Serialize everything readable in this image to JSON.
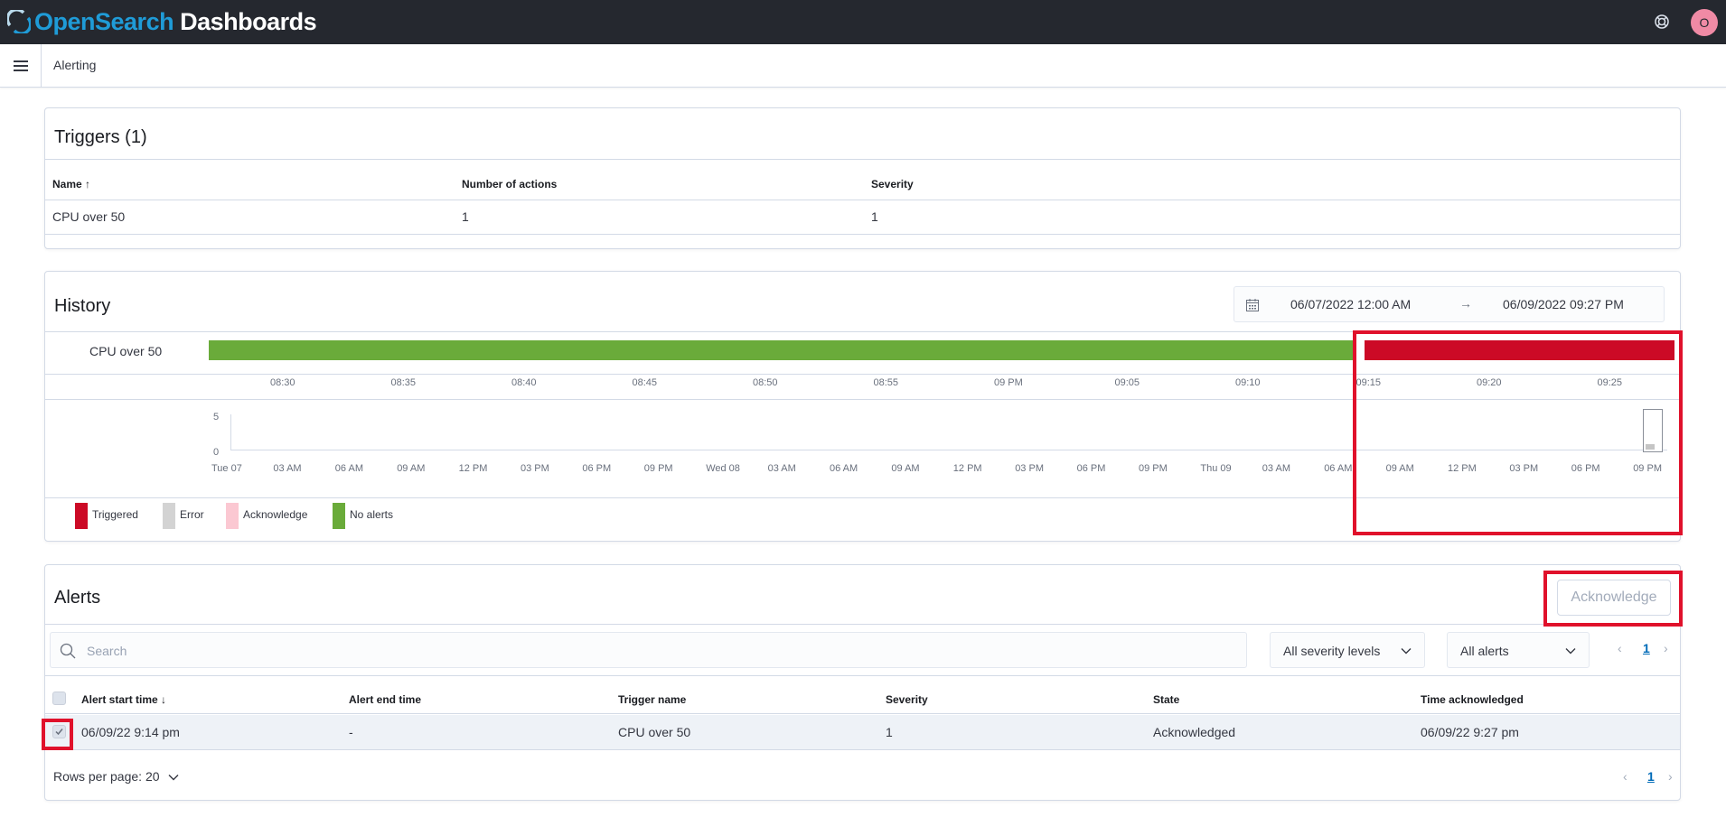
{
  "header": {
    "brand_open": "Open",
    "brand_search": "Search",
    "brand_rest": " Dashboards",
    "avatar_initial": "O",
    "help_icon": "help-icon"
  },
  "breadcrumb": {
    "current": "Alerting"
  },
  "triggers": {
    "title": "Triggers (1)",
    "columns": [
      "Name",
      "Number of actions",
      "Severity"
    ],
    "sort_arrow": "↑",
    "rows": [
      {
        "name": "CPU over 50",
        "actions": "1",
        "severity": "1"
      }
    ]
  },
  "history": {
    "title": "History",
    "date_start": "06/07/2022 12:00 AM",
    "date_arrow": "→",
    "date_end": "06/09/2022 09:27 PM",
    "timeline_label": "CPU over 50",
    "timeline_segments": [
      {
        "state": "No alerts",
        "start": "08:25",
        "end": "09:14",
        "color": "#6aab3a"
      },
      {
        "state": "Triggered",
        "start": "09:14",
        "end": "09:27",
        "color": "#cc0a26"
      }
    ],
    "time_ticks": [
      "08:30",
      "08:35",
      "08:40",
      "08:45",
      "08:50",
      "08:55",
      "09 PM",
      "09:05",
      "09:10",
      "09:15",
      "09:20",
      "09:25"
    ],
    "mini_y": [
      "5",
      "0"
    ],
    "mini_ticks": [
      "Tue 07",
      "03 AM",
      "06 AM",
      "09 AM",
      "12 PM",
      "03 PM",
      "06 PM",
      "09 PM",
      "Wed 08",
      "03 AM",
      "06 AM",
      "09 AM",
      "12 PM",
      "03 PM",
      "06 PM",
      "09 PM",
      "Thu 09",
      "03 AM",
      "06 AM",
      "09 AM",
      "12 PM",
      "03 PM",
      "06 PM",
      "09 PM"
    ],
    "legend": [
      {
        "label": "Triggered",
        "color": "#cc0a26"
      },
      {
        "label": "Error",
        "color": "#d3d3d3"
      },
      {
        "label": "Acknowledge",
        "color": "#fbc8d2"
      },
      {
        "label": "No alerts",
        "color": "#6aab3a"
      }
    ]
  },
  "alerts": {
    "title": "Alerts",
    "acknowledge_label": "Acknowledge",
    "search_placeholder": "Search",
    "severity_select": "All severity levels",
    "state_select": "All alerts",
    "page": "1",
    "columns": [
      "Alert start time",
      "Alert end time",
      "Trigger name",
      "Severity",
      "State",
      "Time acknowledged"
    ],
    "sort_arrow": "↓",
    "rows": [
      {
        "start": "06/09/22 9:14 pm",
        "end": "-",
        "trigger": "CPU over 50",
        "severity": "1",
        "state": "Acknowledged",
        "acknowledged": "06/09/22 9:27 pm"
      }
    ],
    "rows_per_page": "Rows per page: 20"
  },
  "colors": {
    "accent": "#006bb8",
    "highlight": "#e0112b",
    "header_bg": "#25282f"
  }
}
